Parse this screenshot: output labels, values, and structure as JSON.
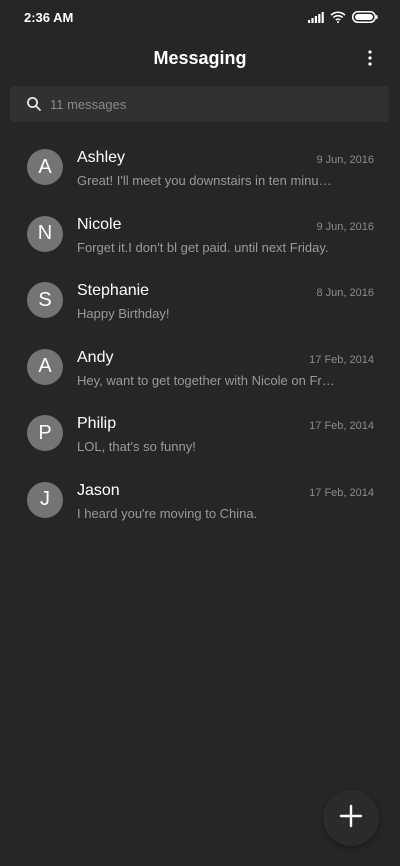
{
  "status_bar": {
    "time": "2:36 AM",
    "icons": [
      "signal-icon",
      "wifi-icon",
      "battery-icon"
    ]
  },
  "header": {
    "title": "Messaging",
    "more_icon": "more-vertical-icon"
  },
  "search": {
    "icon": "search-icon",
    "placeholder": "11 messages"
  },
  "conversations": [
    {
      "initial": "A",
      "name": "Ashley",
      "date": "9 Jun, 2016",
      "preview": "Great! I'll meet you downstairs in ten minutes."
    },
    {
      "initial": "N",
      "name": "Nicole",
      "date": "9 Jun, 2016",
      "preview": "Forget it.I don't bl get paid. until next Friday."
    },
    {
      "initial": "S",
      "name": "Stephanie",
      "date": "8 Jun, 2016",
      "preview": "Happy Birthday!"
    },
    {
      "initial": "A",
      "name": "Andy",
      "date": "17 Feb, 2014",
      "preview": "Hey, want to get together with Nicole on Friday?"
    },
    {
      "initial": "P",
      "name": "Philip",
      "date": "17 Feb, 2014",
      "preview": "LOL, that's so funny!"
    },
    {
      "initial": "J",
      "name": "Jason",
      "date": "17 Feb, 2014",
      "preview": "I heard you're moving to China."
    }
  ],
  "fab": {
    "icon": "plus-icon"
  },
  "colors": {
    "background": "#262626",
    "search_background": "#313131",
    "avatar": "#747474",
    "secondary_text": "#9a9a9a",
    "date_text": "#8c8c8c"
  }
}
